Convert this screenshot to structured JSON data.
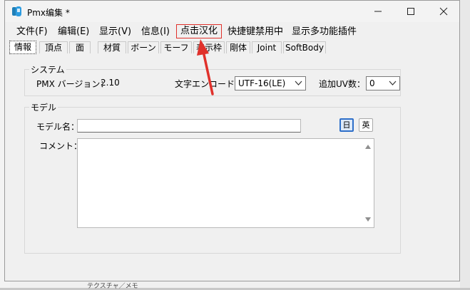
{
  "window": {
    "title": "Pmx编集 *"
  },
  "menu": [
    {
      "label": "文件(F)"
    },
    {
      "label": "编辑(E)"
    },
    {
      "label": "显示(V)"
    },
    {
      "label": "信息(I)"
    },
    {
      "label": "点击汉化"
    },
    {
      "label": "快捷键禁用中"
    },
    {
      "label": "显示多功能插件"
    }
  ],
  "tabs": [
    {
      "label": "情報"
    },
    {
      "label": "頂点"
    },
    {
      "label": "面"
    },
    {
      "label": "材質"
    },
    {
      "label": "ボーン"
    },
    {
      "label": "モーフ"
    },
    {
      "label": "表示枠"
    },
    {
      "label": "剛体"
    },
    {
      "label": "Joint"
    },
    {
      "label": "SoftBody"
    }
  ],
  "system": {
    "group_title": "システム",
    "pmx_version_label": "PMX バージョン：",
    "pmx_version_value": "2.10",
    "encoding_label": "文字エンコード：",
    "encoding_value": "UTF-16(LE)",
    "uv_label": "追加UV数：",
    "uv_value": "0"
  },
  "model": {
    "group_title": "モデル",
    "name_label": "モデル名：",
    "name_value": "",
    "lang_jp": "日",
    "lang_en": "英",
    "comment_label": "コメント：",
    "comment_value": ""
  },
  "background": {
    "bottom_fragment": "テクスチャ／メモ"
  },
  "colors": {
    "annotation": "#e0312b",
    "accent": "#2e6fc9"
  }
}
